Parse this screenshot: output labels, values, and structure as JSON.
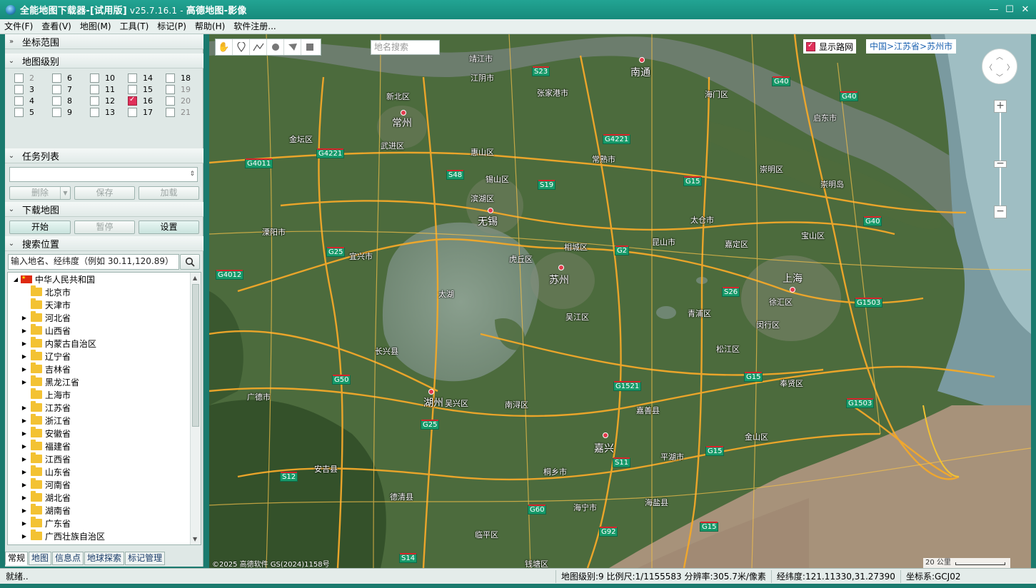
{
  "window": {
    "title_main": "全能地图下载器-[试用版]",
    "title_version": " v25.7.16.1 - ",
    "title_suffix": "高德地图-影像",
    "min_glyph": "—",
    "max_glyph": "☐",
    "close_glyph": "✕"
  },
  "menu": [
    "文件(F)",
    "查看(V)",
    "地图(M)",
    "工具(T)",
    "标记(P)",
    "帮助(H)",
    "软件注册..."
  ],
  "left_panel": {
    "coord_section": "坐标范围",
    "level_section": "地图级别",
    "levels": [
      {
        "num": "2",
        "checked": false,
        "dim": true
      },
      {
        "num": "3",
        "checked": false,
        "dim": false
      },
      {
        "num": "4",
        "checked": false,
        "dim": false
      },
      {
        "num": "5",
        "checked": false,
        "dim": false
      },
      {
        "num": "6",
        "checked": false,
        "dim": false
      },
      {
        "num": "7",
        "checked": false,
        "dim": false
      },
      {
        "num": "8",
        "checked": false,
        "dim": false
      },
      {
        "num": "9",
        "checked": false,
        "dim": false
      },
      {
        "num": "10",
        "checked": false,
        "dim": false
      },
      {
        "num": "11",
        "checked": false,
        "dim": false
      },
      {
        "num": "12",
        "checked": false,
        "dim": false
      },
      {
        "num": "13",
        "checked": false,
        "dim": false
      },
      {
        "num": "14",
        "checked": false,
        "dim": false
      },
      {
        "num": "15",
        "checked": false,
        "dim": false
      },
      {
        "num": "16",
        "checked": true,
        "dim": false
      },
      {
        "num": "17",
        "checked": false,
        "dim": false
      },
      {
        "num": "18",
        "checked": false,
        "dim": false
      },
      {
        "num": "19",
        "checked": false,
        "dim": true
      },
      {
        "num": "20",
        "checked": false,
        "dim": true
      },
      {
        "num": "21",
        "checked": false,
        "dim": true
      }
    ],
    "task_section": "任务列表",
    "task_buttons": {
      "delete": "删除",
      "save": "保存",
      "load": "加载"
    },
    "download_section": "下载地图",
    "download_buttons": {
      "start": "开始",
      "pause": "暂停",
      "settings": "设置"
    },
    "search_section": "搜索位置",
    "search_placeholder": "输入地名、经纬度（例如 30.11,120.89）",
    "tree_root": "中华人民共和国",
    "tree_items": [
      {
        "label": "北京市",
        "expandable": false
      },
      {
        "label": "天津市",
        "expandable": false
      },
      {
        "label": "河北省",
        "expandable": true
      },
      {
        "label": "山西省",
        "expandable": true
      },
      {
        "label": "内蒙古自治区",
        "expandable": true
      },
      {
        "label": "辽宁省",
        "expandable": true
      },
      {
        "label": "吉林省",
        "expandable": true
      },
      {
        "label": "黑龙江省",
        "expandable": true
      },
      {
        "label": "上海市",
        "expandable": false
      },
      {
        "label": "江苏省",
        "expandable": true
      },
      {
        "label": "浙江省",
        "expandable": true
      },
      {
        "label": "安徽省",
        "expandable": true
      },
      {
        "label": "福建省",
        "expandable": true
      },
      {
        "label": "江西省",
        "expandable": true
      },
      {
        "label": "山东省",
        "expandable": true
      },
      {
        "label": "河南省",
        "expandable": true
      },
      {
        "label": "湖北省",
        "expandable": true
      },
      {
        "label": "湖南省",
        "expandable": true
      },
      {
        "label": "广东省",
        "expandable": true
      },
      {
        "label": "广西壮族自治区",
        "expandable": true
      }
    ],
    "bottom_tabs": [
      "常规",
      "地图",
      "信息点",
      "地球探索",
      "标记管理"
    ]
  },
  "map": {
    "search_placeholder": "地名搜索",
    "road_network": "显示路网",
    "breadcrumb": "中国>江苏省>苏州市",
    "scale": "20 公里",
    "copyright": "©2025 高德软件 GS(2024)1158号",
    "tools": [
      "pan-hand-icon",
      "marker-icon",
      "polyline-icon",
      "circle-icon",
      "polygon-icon",
      "rectangle-icon"
    ],
    "labels": [
      {
        "t": "靖江市"
      },
      {
        "t": "江阴市"
      },
      {
        "t": "南通",
        "big": true
      },
      {
        "t": "张家港市"
      },
      {
        "t": "海门区"
      },
      {
        "t": "新北区"
      },
      {
        "t": "常州",
        "big": true
      },
      {
        "t": "启东市"
      },
      {
        "t": "金坛区"
      },
      {
        "t": "武进区"
      },
      {
        "t": "常熟市"
      },
      {
        "t": "惠山区"
      },
      {
        "t": "崇明区"
      },
      {
        "t": "锡山区"
      },
      {
        "t": "崇明岛"
      },
      {
        "t": "滨湖区"
      },
      {
        "t": "无锡",
        "big": true
      },
      {
        "t": "太仓市"
      },
      {
        "t": "溧阳市"
      },
      {
        "t": "嘉定区"
      },
      {
        "t": "宝山区"
      },
      {
        "t": "相城区"
      },
      {
        "t": "昆山市"
      },
      {
        "t": "宜兴市"
      },
      {
        "t": "虎丘区"
      },
      {
        "t": "上海",
        "big": true
      },
      {
        "t": "苏州",
        "big": true
      },
      {
        "t": "太湖"
      },
      {
        "t": "徐汇区"
      },
      {
        "t": "青浦区"
      },
      {
        "t": "吴江区"
      },
      {
        "t": "闵行区"
      },
      {
        "t": "长兴县"
      },
      {
        "t": "松江区"
      },
      {
        "t": "广德市"
      },
      {
        "t": "湖州",
        "big": true
      },
      {
        "t": "吴兴区"
      },
      {
        "t": "南浔区"
      },
      {
        "t": "奉贤区"
      },
      {
        "t": "嘉善县"
      },
      {
        "t": "嘉兴",
        "big": true
      },
      {
        "t": "金山区"
      },
      {
        "t": "安吉县"
      },
      {
        "t": "平湖市"
      },
      {
        "t": "桐乡市"
      },
      {
        "t": "德清县"
      },
      {
        "t": "海盐县"
      },
      {
        "t": "海宁市"
      },
      {
        "t": "临平区"
      },
      {
        "t": "钱塘区"
      }
    ],
    "highways": [
      "S23",
      "G40",
      "G40",
      "G4221",
      "G4221",
      "G4011",
      "S48",
      "S19",
      "G15",
      "G40",
      "G2",
      "G25",
      "G4012",
      "S26",
      "G1503",
      "G50",
      "G15",
      "G1521",
      "G1503",
      "G25",
      "S12",
      "S11",
      "G15",
      "G60",
      "G92",
      "S14",
      "G15"
    ]
  },
  "status": {
    "ready": "就绪..",
    "level_scale": "地图级别:9 比例尺:1/1155583 分辨率:305.7米/像素",
    "lonlat": "经纬度:121.11330,31.27390",
    "crs": "坐标系:GCJ02"
  },
  "colors": {
    "title_bar": "#1a9685",
    "accent_check": "#e0305a",
    "highway_shield": "#179a6a"
  }
}
